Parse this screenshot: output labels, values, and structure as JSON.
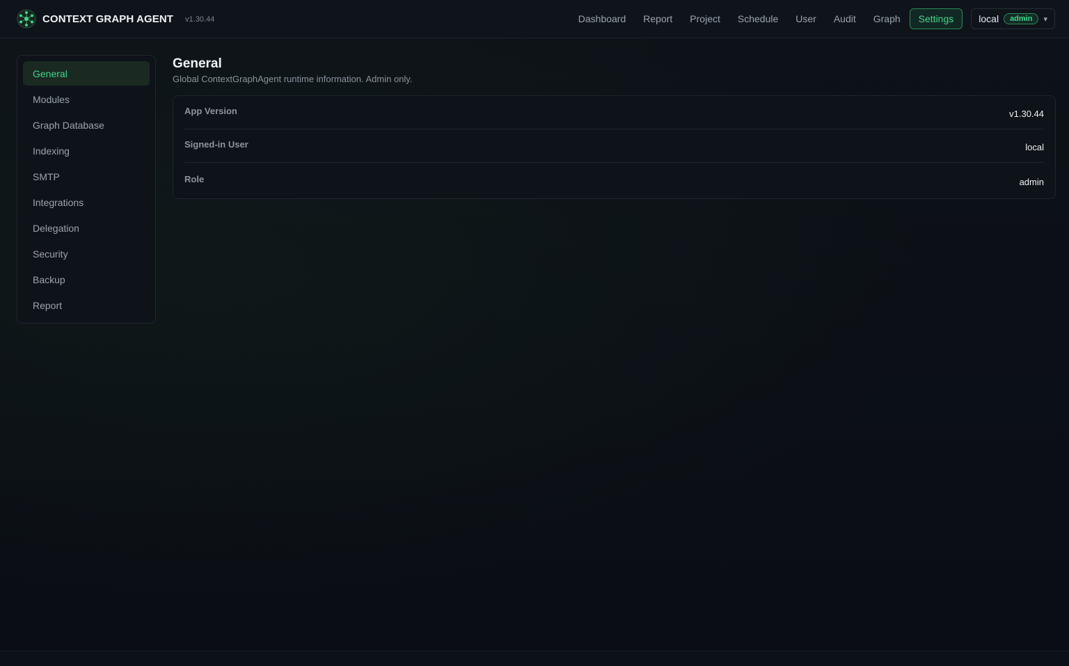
{
  "header": {
    "app_title": "CONTEXT GRAPH AGENT",
    "version": "v1.30.44",
    "logo_icon": "network-graph-icon",
    "accent_color": "#3fd68a",
    "nav": [
      {
        "label": "Dashboard",
        "active": false
      },
      {
        "label": "Report",
        "active": false
      },
      {
        "label": "Project",
        "active": false
      },
      {
        "label": "Schedule",
        "active": false
      },
      {
        "label": "User",
        "active": false
      },
      {
        "label": "Audit",
        "active": false
      },
      {
        "label": "Graph",
        "active": false
      },
      {
        "label": "Settings",
        "active": true
      }
    ],
    "user": {
      "name": "local",
      "role": "admin",
      "caret": "▾"
    }
  },
  "sidebar": {
    "items": [
      {
        "label": "General",
        "active": true
      },
      {
        "label": "Modules",
        "active": false
      },
      {
        "label": "Graph Database",
        "active": false
      },
      {
        "label": "Indexing",
        "active": false
      },
      {
        "label": "SMTP",
        "active": false
      },
      {
        "label": "Integrations",
        "active": false
      },
      {
        "label": "Delegation",
        "active": false
      },
      {
        "label": "Security",
        "active": false
      },
      {
        "label": "Backup",
        "active": false
      },
      {
        "label": "Report",
        "active": false
      }
    ]
  },
  "main": {
    "title": "General",
    "subtitle": "Global ContextGraphAgent runtime information. Admin only.",
    "info_rows": [
      {
        "label": "App Version",
        "value": "v1.30.44"
      },
      {
        "label": "Signed-in User",
        "value": "local"
      },
      {
        "label": "Role",
        "value": "admin"
      }
    ]
  }
}
